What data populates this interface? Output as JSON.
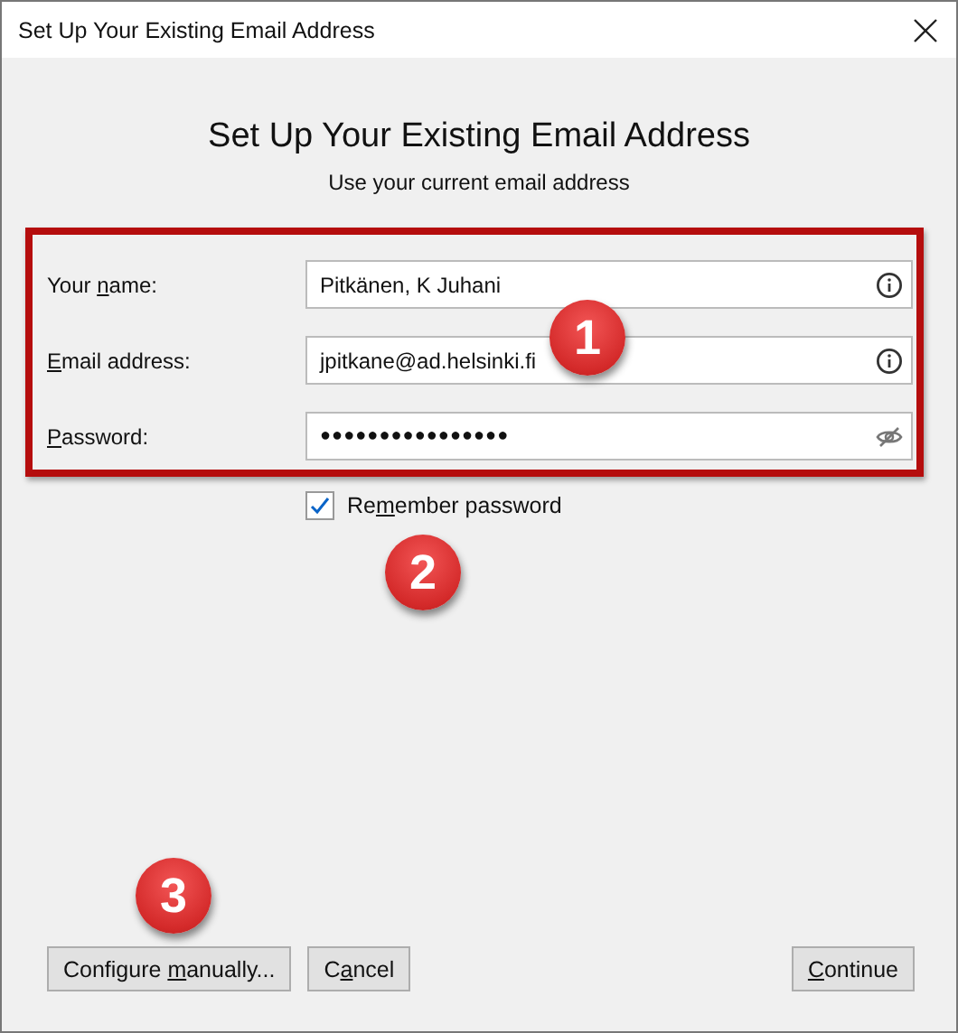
{
  "window": {
    "title": "Set Up Your Existing Email Address"
  },
  "heading": "Set Up Your Existing Email Address",
  "subtitle": "Use your current email address",
  "fields": [
    {
      "kind": "text",
      "label": {
        "before": "Your ",
        "key": "n",
        "after": "ame:"
      },
      "value": "Pitkänen, K Juhani"
    },
    {
      "kind": "text",
      "label": {
        "key": "E",
        "after": "mail address:"
      },
      "value": "jpitkane@ad.helsinki.fi"
    },
    {
      "kind": "password",
      "label": {
        "key": "P",
        "after": "assword:"
      },
      "value": "●●●●●●●●●●●●●●●●"
    }
  ],
  "remember": {
    "label": {
      "before": "Re",
      "key": "m",
      "after": "ember password"
    },
    "checked": true
  },
  "buttons": [
    {
      "label": {
        "before": "Configure ",
        "key": "m",
        "after": "anually..."
      }
    },
    {
      "label": {
        "before": "C",
        "key": "a",
        "after": "ncel"
      }
    },
    {
      "label": {
        "key": "C",
        "after": "ontinue"
      }
    }
  ],
  "callouts": [
    "1",
    "2",
    "3"
  ]
}
